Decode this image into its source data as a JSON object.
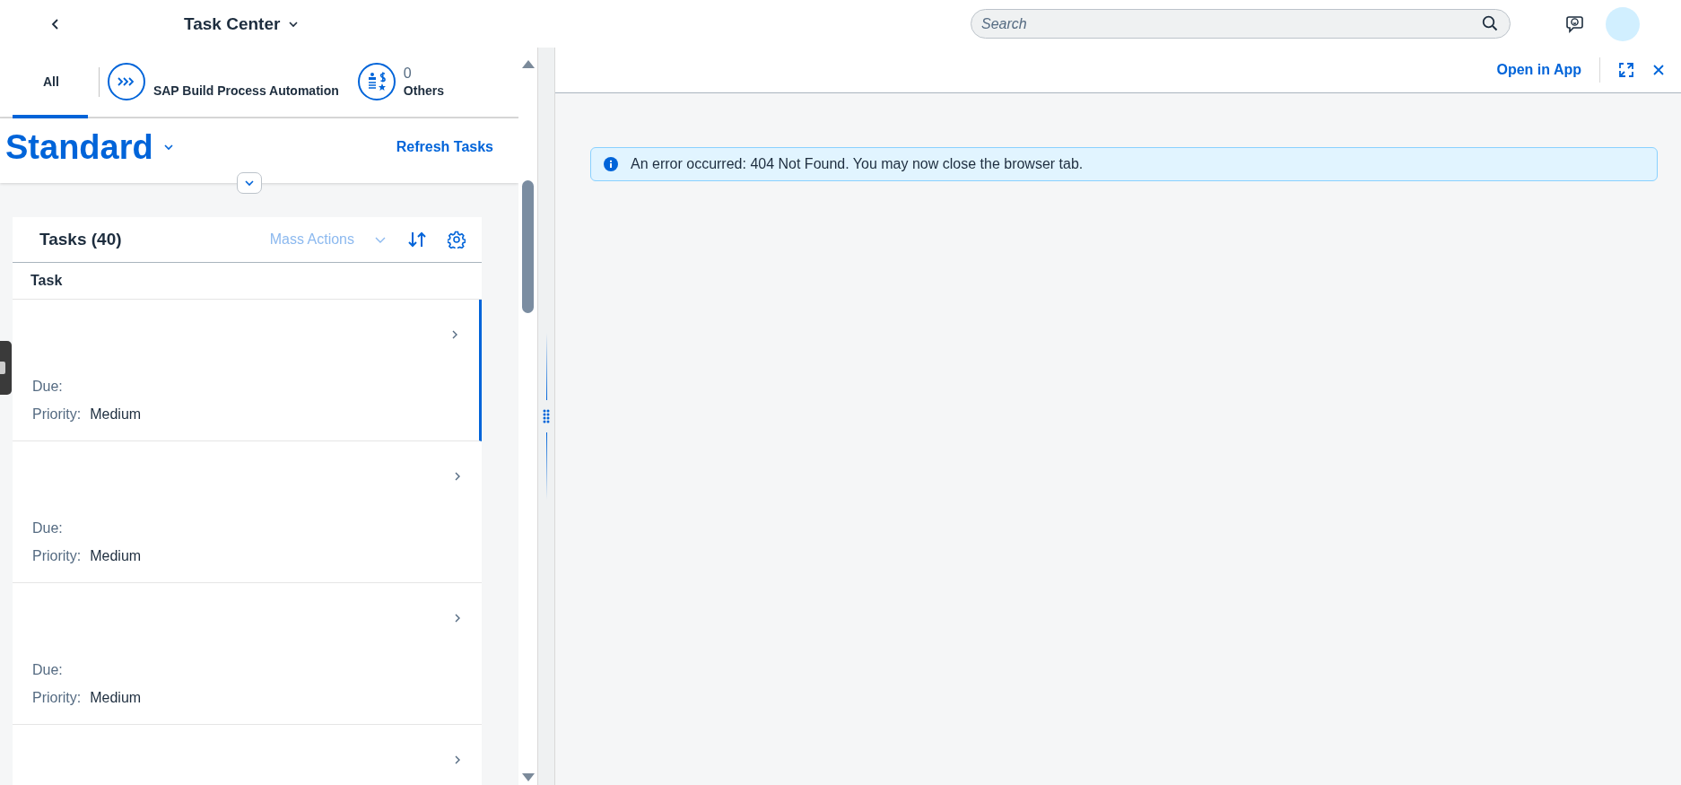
{
  "header": {
    "title": "Task Center",
    "search": {
      "placeholder": "Search"
    }
  },
  "source_tabs": [
    {
      "kind": "plain",
      "label": "All",
      "selected": true
    },
    {
      "kind": "automation",
      "label": "SAP Build Process Automation",
      "selected": false
    },
    {
      "kind": "others",
      "count": "0",
      "label": "Others",
      "selected": false
    }
  ],
  "variant": {
    "title": "Standard",
    "refresh": "Refresh Tasks"
  },
  "tasks": {
    "title": "Tasks (40)",
    "mass_actions": "Mass Actions",
    "mass_actions_disabled": true,
    "column": "Task",
    "rows": [
      {
        "selected": true,
        "due_label": "Due:",
        "priority_label": "Priority:",
        "priority": "Medium"
      },
      {
        "selected": false,
        "due_label": "Due:",
        "priority_label": "Priority:",
        "priority": "Medium"
      },
      {
        "selected": false,
        "due_label": "Due:",
        "priority_label": "Priority:",
        "priority": "Medium"
      },
      {
        "selected": false
      }
    ]
  },
  "detail": {
    "open_in_app": "Open in App",
    "message": "An error occurred: 404 Not Found. You may now close the browser tab."
  }
}
